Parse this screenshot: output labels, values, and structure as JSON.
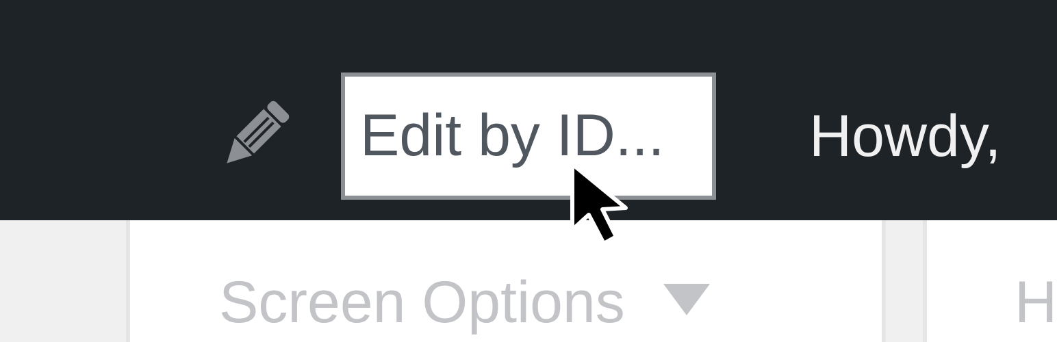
{
  "admin_bar": {
    "edit_by_id": "Edit by ID...",
    "greeting": "Howdy,",
    "icons": {
      "edit": "pencil-icon"
    }
  },
  "screen_meta": {
    "screen_options_label": "Screen Options",
    "help_label": "H",
    "icons": {
      "toggle": "caret-down-icon"
    }
  },
  "colors": {
    "adminbar_bg": "#1d2327",
    "input_border": "#8c8f94",
    "input_text": "#50575e",
    "muted_text": "#c3c4c7",
    "page_bg": "#f0f0f1"
  }
}
